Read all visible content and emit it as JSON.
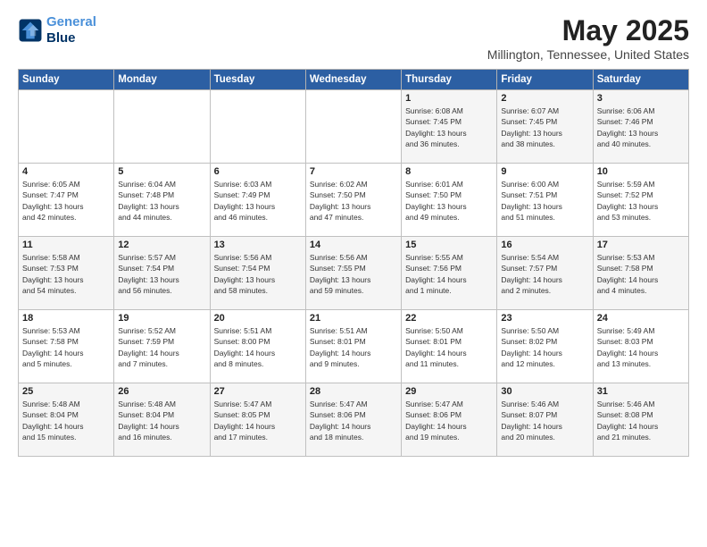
{
  "logo": {
    "line1": "General",
    "line2": "Blue"
  },
  "title": "May 2025",
  "subtitle": "Millington, Tennessee, United States",
  "header_days": [
    "Sunday",
    "Monday",
    "Tuesday",
    "Wednesday",
    "Thursday",
    "Friday",
    "Saturday"
  ],
  "weeks": [
    [
      {
        "day": "",
        "info": ""
      },
      {
        "day": "",
        "info": ""
      },
      {
        "day": "",
        "info": ""
      },
      {
        "day": "",
        "info": ""
      },
      {
        "day": "1",
        "info": "Sunrise: 6:08 AM\nSunset: 7:45 PM\nDaylight: 13 hours\nand 36 minutes."
      },
      {
        "day": "2",
        "info": "Sunrise: 6:07 AM\nSunset: 7:45 PM\nDaylight: 13 hours\nand 38 minutes."
      },
      {
        "day": "3",
        "info": "Sunrise: 6:06 AM\nSunset: 7:46 PM\nDaylight: 13 hours\nand 40 minutes."
      }
    ],
    [
      {
        "day": "4",
        "info": "Sunrise: 6:05 AM\nSunset: 7:47 PM\nDaylight: 13 hours\nand 42 minutes."
      },
      {
        "day": "5",
        "info": "Sunrise: 6:04 AM\nSunset: 7:48 PM\nDaylight: 13 hours\nand 44 minutes."
      },
      {
        "day": "6",
        "info": "Sunrise: 6:03 AM\nSunset: 7:49 PM\nDaylight: 13 hours\nand 46 minutes."
      },
      {
        "day": "7",
        "info": "Sunrise: 6:02 AM\nSunset: 7:50 PM\nDaylight: 13 hours\nand 47 minutes."
      },
      {
        "day": "8",
        "info": "Sunrise: 6:01 AM\nSunset: 7:50 PM\nDaylight: 13 hours\nand 49 minutes."
      },
      {
        "day": "9",
        "info": "Sunrise: 6:00 AM\nSunset: 7:51 PM\nDaylight: 13 hours\nand 51 minutes."
      },
      {
        "day": "10",
        "info": "Sunrise: 5:59 AM\nSunset: 7:52 PM\nDaylight: 13 hours\nand 53 minutes."
      }
    ],
    [
      {
        "day": "11",
        "info": "Sunrise: 5:58 AM\nSunset: 7:53 PM\nDaylight: 13 hours\nand 54 minutes."
      },
      {
        "day": "12",
        "info": "Sunrise: 5:57 AM\nSunset: 7:54 PM\nDaylight: 13 hours\nand 56 minutes."
      },
      {
        "day": "13",
        "info": "Sunrise: 5:56 AM\nSunset: 7:54 PM\nDaylight: 13 hours\nand 58 minutes."
      },
      {
        "day": "14",
        "info": "Sunrise: 5:56 AM\nSunset: 7:55 PM\nDaylight: 13 hours\nand 59 minutes."
      },
      {
        "day": "15",
        "info": "Sunrise: 5:55 AM\nSunset: 7:56 PM\nDaylight: 14 hours\nand 1 minute."
      },
      {
        "day": "16",
        "info": "Sunrise: 5:54 AM\nSunset: 7:57 PM\nDaylight: 14 hours\nand 2 minutes."
      },
      {
        "day": "17",
        "info": "Sunrise: 5:53 AM\nSunset: 7:58 PM\nDaylight: 14 hours\nand 4 minutes."
      }
    ],
    [
      {
        "day": "18",
        "info": "Sunrise: 5:53 AM\nSunset: 7:58 PM\nDaylight: 14 hours\nand 5 minutes."
      },
      {
        "day": "19",
        "info": "Sunrise: 5:52 AM\nSunset: 7:59 PM\nDaylight: 14 hours\nand 7 minutes."
      },
      {
        "day": "20",
        "info": "Sunrise: 5:51 AM\nSunset: 8:00 PM\nDaylight: 14 hours\nand 8 minutes."
      },
      {
        "day": "21",
        "info": "Sunrise: 5:51 AM\nSunset: 8:01 PM\nDaylight: 14 hours\nand 9 minutes."
      },
      {
        "day": "22",
        "info": "Sunrise: 5:50 AM\nSunset: 8:01 PM\nDaylight: 14 hours\nand 11 minutes."
      },
      {
        "day": "23",
        "info": "Sunrise: 5:50 AM\nSunset: 8:02 PM\nDaylight: 14 hours\nand 12 minutes."
      },
      {
        "day": "24",
        "info": "Sunrise: 5:49 AM\nSunset: 8:03 PM\nDaylight: 14 hours\nand 13 minutes."
      }
    ],
    [
      {
        "day": "25",
        "info": "Sunrise: 5:48 AM\nSunset: 8:04 PM\nDaylight: 14 hours\nand 15 minutes."
      },
      {
        "day": "26",
        "info": "Sunrise: 5:48 AM\nSunset: 8:04 PM\nDaylight: 14 hours\nand 16 minutes."
      },
      {
        "day": "27",
        "info": "Sunrise: 5:47 AM\nSunset: 8:05 PM\nDaylight: 14 hours\nand 17 minutes."
      },
      {
        "day": "28",
        "info": "Sunrise: 5:47 AM\nSunset: 8:06 PM\nDaylight: 14 hours\nand 18 minutes."
      },
      {
        "day": "29",
        "info": "Sunrise: 5:47 AM\nSunset: 8:06 PM\nDaylight: 14 hours\nand 19 minutes."
      },
      {
        "day": "30",
        "info": "Sunrise: 5:46 AM\nSunset: 8:07 PM\nDaylight: 14 hours\nand 20 minutes."
      },
      {
        "day": "31",
        "info": "Sunrise: 5:46 AM\nSunset: 8:08 PM\nDaylight: 14 hours\nand 21 minutes."
      }
    ]
  ]
}
